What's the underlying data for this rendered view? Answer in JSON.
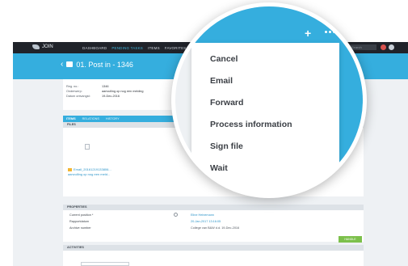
{
  "topbar": {
    "brand": "JOIN",
    "nav": [
      "DASHBOARD",
      "PENDING TASKS",
      "ITEMS",
      "FAVORITES"
    ],
    "search_placeholder": "Search"
  },
  "header": {
    "title": "01. Post in - 1346"
  },
  "meta": [
    {
      "key": "Reg. no.:",
      "value": "1346"
    },
    {
      "key": "Onderwerp:",
      "value": "aanvulling op nog een melding"
    },
    {
      "key": "Datum ontvangst:",
      "value": "19-Dec-2016"
    }
  ],
  "tabs": [
    "ITEMS",
    "RELATIONS",
    "HISTORY"
  ],
  "sections": {
    "files": "FILES",
    "properties": "PROPERTIES",
    "activities": "ACTIVITIES"
  },
  "file": {
    "name": "Email_20161219133806...",
    "subtitle": "aanvulling op nog een meld..."
  },
  "properties": [
    {
      "key": "Current position *",
      "value": "Eline Heinemann",
      "style": "link"
    },
    {
      "key": "Rapportdatum",
      "value": "20-Jan-2017 13:16:05",
      "style": "link"
    },
    {
      "key": "Archive number",
      "value": "College van B&W d.d. 19-Dec-2016",
      "style": "plain"
    }
  ],
  "green_button": "HANDLE",
  "menu": {
    "items": [
      "Cancel",
      "Email",
      "Forward",
      "Process information",
      "Sign file",
      "Wait"
    ]
  },
  "colors": {
    "accent": "#35aede",
    "dark": "#20232a",
    "success": "#7cc04b"
  }
}
